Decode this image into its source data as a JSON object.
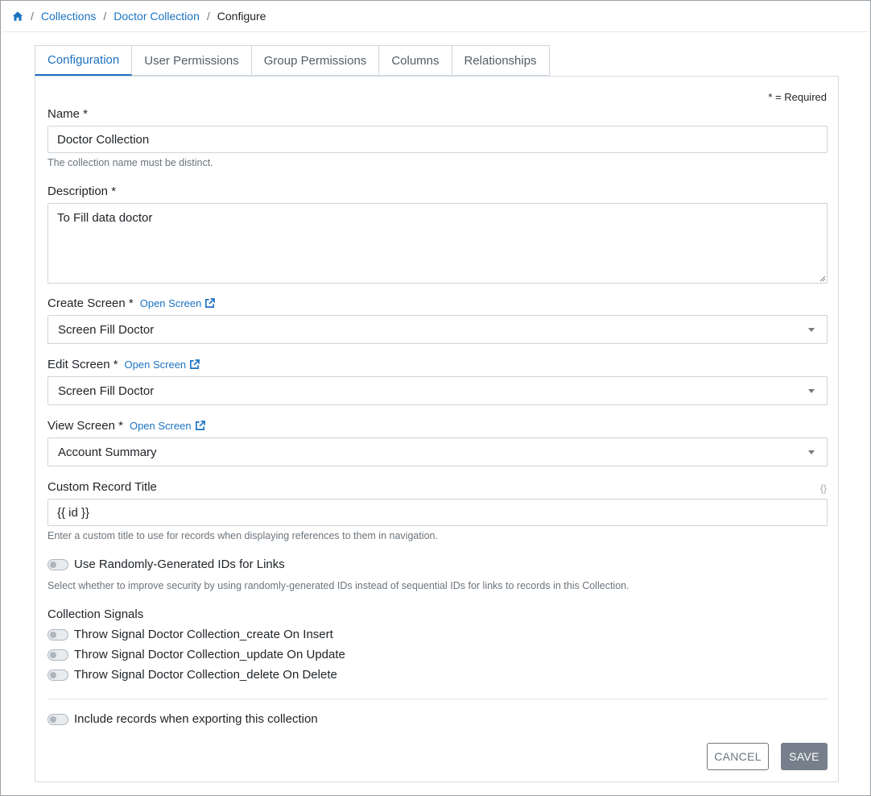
{
  "breadcrumb": {
    "home_icon": "home-icon",
    "items": [
      "Collections",
      "Doctor Collection"
    ],
    "current": "Configure",
    "separator": "/"
  },
  "tabs": [
    {
      "label": "Configuration",
      "active": true
    },
    {
      "label": "User Permissions",
      "active": false
    },
    {
      "label": "Group Permissions",
      "active": false
    },
    {
      "label": "Columns",
      "active": false
    },
    {
      "label": "Relationships",
      "active": false
    }
  ],
  "form": {
    "required_note": "* = Required",
    "name": {
      "label": "Name *",
      "value": "Doctor Collection",
      "help": "The collection name must be distinct."
    },
    "description": {
      "label": "Description *",
      "value": "To Fill data doctor"
    },
    "create_screen": {
      "label": "Create Screen *",
      "link": "Open Screen",
      "value": "Screen Fill Doctor"
    },
    "edit_screen": {
      "label": "Edit Screen *",
      "link": "Open Screen",
      "value": "Screen Fill Doctor"
    },
    "view_screen": {
      "label": "View Screen *",
      "link": "Open Screen",
      "value": "Account Summary"
    },
    "custom_title": {
      "label": "Custom Record Title",
      "braces": "{}",
      "value": "{{ id }}",
      "help": "Enter a custom title to use for records when displaying references to them in navigation."
    },
    "random_ids": {
      "label": "Use Randomly-Generated IDs for Links",
      "enabled": false,
      "help": "Select whether to improve security by using randomly-generated IDs instead of sequential IDs for links to records in this Collection."
    },
    "signals": {
      "title": "Collection Signals",
      "items": [
        {
          "label": "Throw Signal Doctor Collection_create On Insert",
          "enabled": false
        },
        {
          "label": "Throw Signal Doctor Collection_update On Update",
          "enabled": false
        },
        {
          "label": "Throw Signal Doctor Collection_delete On Delete",
          "enabled": false
        }
      ]
    },
    "export": {
      "label": "Include records when exporting this collection",
      "enabled": false
    },
    "cancel_label": "CANCEL",
    "save_label": "SAVE"
  },
  "colors": {
    "link": "#1c72c2",
    "save_bg": "#75808c",
    "border": "#ced4da"
  }
}
